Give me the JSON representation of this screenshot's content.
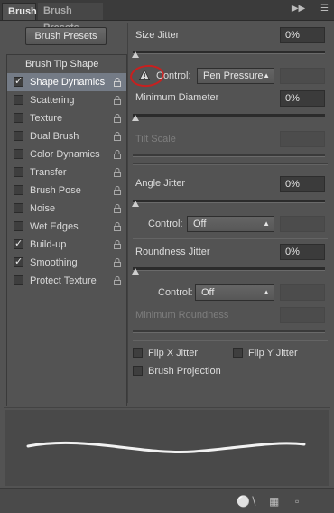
{
  "tabs": [
    {
      "label": "Brush"
    },
    {
      "label": "Brush Presets"
    }
  ],
  "header_icons": [
    "double-arrow-icon",
    "panel-menu-icon"
  ],
  "left": {
    "presets_button": "Brush Presets",
    "items": [
      {
        "label": "Brush Tip Shape",
        "checked": null
      },
      {
        "label": "Shape Dynamics",
        "checked": true,
        "selected": true
      },
      {
        "label": "Scattering",
        "checked": false
      },
      {
        "label": "Texture",
        "checked": false
      },
      {
        "label": "Dual Brush",
        "checked": false
      },
      {
        "label": "Color Dynamics",
        "checked": false
      },
      {
        "label": "Transfer",
        "checked": false
      },
      {
        "label": "Brush Pose",
        "checked": false
      },
      {
        "label": "Noise",
        "checked": false
      },
      {
        "label": "Wet Edges",
        "checked": false
      },
      {
        "label": "Build-up",
        "checked": true
      },
      {
        "label": "Smoothing",
        "checked": true
      },
      {
        "label": "Protect Texture",
        "checked": false
      }
    ]
  },
  "right": {
    "size_jitter": {
      "label": "Size Jitter",
      "value": "0%"
    },
    "control1": {
      "label": "Control:",
      "value": "Pen Pressure"
    },
    "min_diameter": {
      "label": "Minimum Diameter",
      "value": "0%"
    },
    "tilt_scale": {
      "label": "Tilt Scale"
    },
    "angle_jitter": {
      "label": "Angle Jitter",
      "value": "0%"
    },
    "control2": {
      "label": "Control:",
      "value": "Off"
    },
    "roundness_jitter": {
      "label": "Roundness Jitter",
      "value": "0%"
    },
    "control3": {
      "label": "Control:",
      "value": "Off"
    },
    "min_roundness": {
      "label": "Minimum Roundness"
    },
    "flip_x": {
      "label": "Flip X Jitter",
      "checked": false
    },
    "flip_y": {
      "label": "Flip Y Jitter",
      "checked": false
    },
    "brush_projection": {
      "label": "Brush Projection",
      "checked": false
    }
  },
  "footer_icons": [
    "brush-toggle-icon",
    "grid-icon",
    "new-preset-icon"
  ],
  "colors": {
    "panel": "#535353",
    "selected": "#747b86",
    "annotation": "#c8201f"
  }
}
